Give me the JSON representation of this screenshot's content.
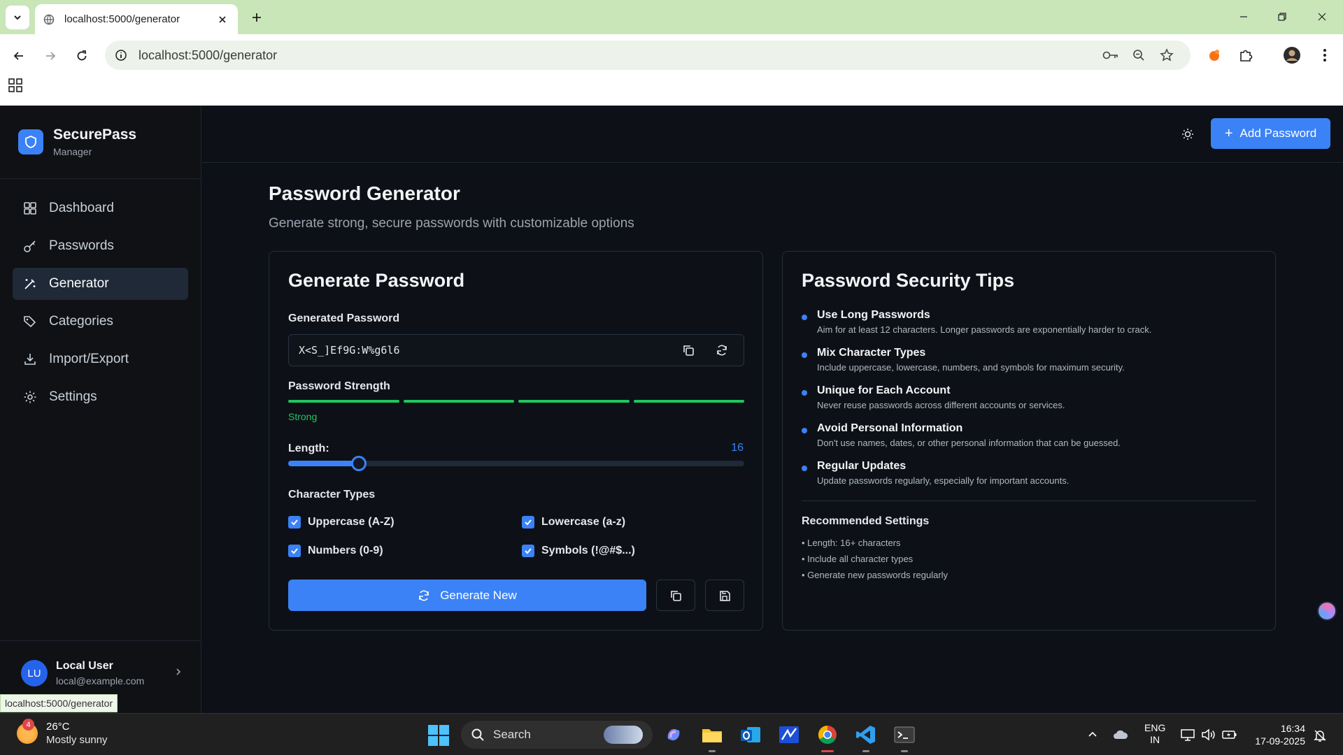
{
  "browser": {
    "tab_title": "localhost:5000/generator",
    "url": "localhost:5000/generator",
    "status_url": "localhost:5000/generator"
  },
  "app": {
    "brand_title": "SecurePass",
    "brand_subtitle": "Manager",
    "accent_color": "#3b82f6",
    "nav": [
      {
        "label": "Dashboard",
        "icon": "grid-icon",
        "active": false
      },
      {
        "label": "Passwords",
        "icon": "key-icon",
        "active": false
      },
      {
        "label": "Generator",
        "icon": "wand-icon",
        "active": true
      },
      {
        "label": "Categories",
        "icon": "tags-icon",
        "active": false
      },
      {
        "label": "Import/Export",
        "icon": "download-icon",
        "active": false
      },
      {
        "label": "Settings",
        "icon": "gear-icon",
        "active": false
      }
    ],
    "user": {
      "initials": "LU",
      "name": "Local User",
      "email": "local@example.com"
    },
    "add_button_label": "Add Password"
  },
  "page": {
    "title": "Password Generator",
    "description": "Generate strong, secure passwords with customizable options"
  },
  "generator": {
    "card_title": "Generate Password",
    "generated_label": "Generated Password",
    "password": "X<S_]Ef9G:W%g6l6",
    "strength_label": "Password Strength",
    "strength_value": "Strong",
    "strength_color": "#22c55e",
    "length_label": "Length:",
    "length_value": "16",
    "length_fraction": 0.155,
    "char_types_label": "Character Types",
    "options": [
      {
        "label": "Uppercase (A-Z)",
        "checked": true
      },
      {
        "label": "Lowercase (a-z)",
        "checked": true
      },
      {
        "label": "Numbers (0-9)",
        "checked": true
      },
      {
        "label": "Symbols (!@#$...)",
        "checked": true
      }
    ],
    "generate_button_label": "Generate New"
  },
  "tips": {
    "card_title": "Password Security Tips",
    "items": [
      {
        "title": "Use Long Passwords",
        "desc": "Aim for at least 12 characters. Longer passwords are exponentially harder to crack."
      },
      {
        "title": "Mix Character Types",
        "desc": "Include uppercase, lowercase, numbers, and symbols for maximum security."
      },
      {
        "title": "Unique for Each Account",
        "desc": "Never reuse passwords across different accounts or services."
      },
      {
        "title": "Avoid Personal Information",
        "desc": "Don't use names, dates, or other personal information that can be guessed."
      },
      {
        "title": "Regular Updates",
        "desc": "Update passwords regularly, especially for important accounts."
      }
    ],
    "recommended_title": "Recommended Settings",
    "recommended": [
      "• Length: 16+ characters",
      "• Include all character types",
      "• Generate new passwords regularly"
    ]
  },
  "taskbar": {
    "weather_badge": "4",
    "temperature": "26°C",
    "weather_desc": "Mostly sunny",
    "search_label": "Search",
    "lang_top": "ENG",
    "lang_bottom": "IN",
    "time": "16:34",
    "date": "17-09-2025"
  }
}
